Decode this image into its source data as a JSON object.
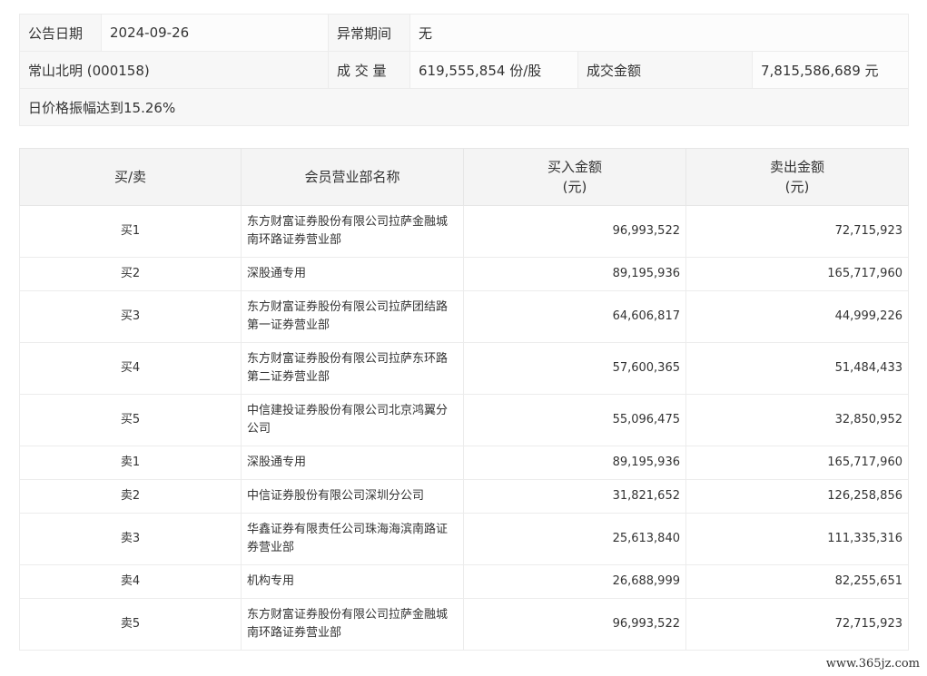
{
  "announcement": {
    "date_label": "公告日期",
    "date_value": "2024-09-26",
    "abnormal_label": "异常期间",
    "abnormal_value": "无",
    "stock_name": "常山北明 (000158)",
    "volume_label": "成 交 量",
    "volume_value": "619,555,854 份/股",
    "amount_label": "成交金额",
    "amount_value": "7,815,586,689 元",
    "reason": "日价格振幅达到15.26%"
  },
  "table": {
    "headers": {
      "side": "买/卖",
      "name": "会员营业部名称",
      "buy_line1": "买入金额",
      "buy_line2": "(元)",
      "sell_line1": "卖出金额",
      "sell_line2": "(元)"
    },
    "rows": [
      {
        "side": "买1",
        "name": "东方财富证券股份有限公司拉萨金融城南环路证券营业部",
        "buy": "96,993,522",
        "sell": "72,715,923"
      },
      {
        "side": "买2",
        "name": "深股通专用",
        "buy": "89,195,936",
        "sell": "165,717,960"
      },
      {
        "side": "买3",
        "name": "东方财富证券股份有限公司拉萨团结路第一证券营业部",
        "buy": "64,606,817",
        "sell": "44,999,226"
      },
      {
        "side": "买4",
        "name": "东方财富证券股份有限公司拉萨东环路第二证券营业部",
        "buy": "57,600,365",
        "sell": "51,484,433"
      },
      {
        "side": "买5",
        "name": "中信建投证券股份有限公司北京鸿翼分公司",
        "buy": "55,096,475",
        "sell": "32,850,952"
      },
      {
        "side": "卖1",
        "name": "深股通专用",
        "buy": "89,195,936",
        "sell": "165,717,960"
      },
      {
        "side": "卖2",
        "name": "中信证券股份有限公司深圳分公司",
        "buy": "31,821,652",
        "sell": "126,258,856"
      },
      {
        "side": "卖3",
        "name": "华鑫证券有限责任公司珠海海滨南路证券营业部",
        "buy": "25,613,840",
        "sell": "111,335,316"
      },
      {
        "side": "卖4",
        "name": "机构专用",
        "buy": "26,688,999",
        "sell": "82,255,651"
      },
      {
        "side": "卖5",
        "name": "东方财富证券股份有限公司拉萨金融城南环路证券营业部",
        "buy": "96,993,522",
        "sell": "72,715,923"
      }
    ]
  },
  "watermark": "www.365jz.com"
}
